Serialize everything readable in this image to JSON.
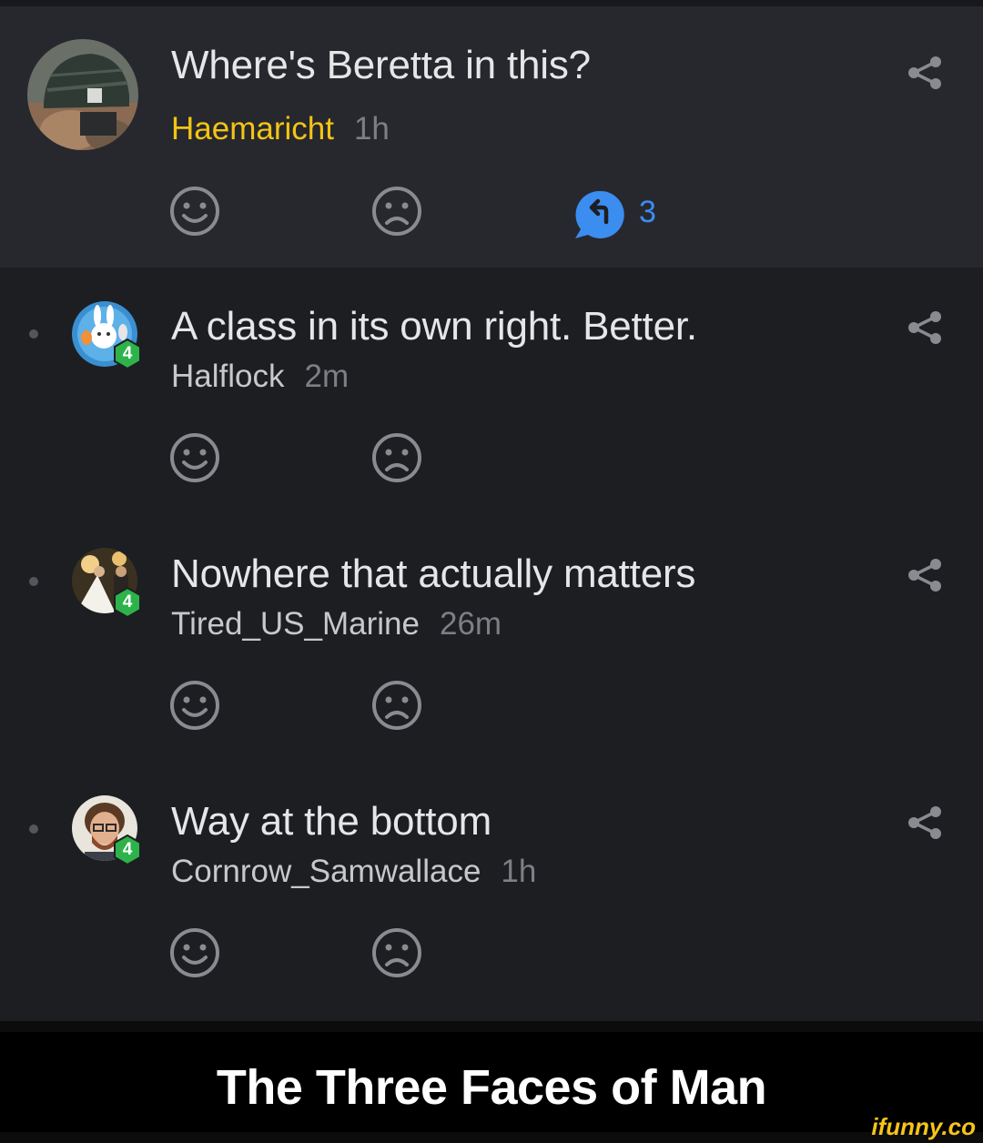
{
  "comments": [
    {
      "text": "Where's Beretta in this?",
      "username": "Haemaricht",
      "time": "1h",
      "is_op": true,
      "replies_count": "3",
      "avatar_icon": "helmet-avatar",
      "badge": ""
    },
    {
      "text": "A class in its own right. Better.",
      "username": "Halflock",
      "time": "2m",
      "avatar_icon": "bunny-avatar",
      "badge": "4"
    },
    {
      "text": "Nowhere that actually matters",
      "username": "Tired_US_Marine",
      "time": "26m",
      "avatar_icon": "wedding-avatar",
      "badge": "4"
    },
    {
      "text": "Way at the bottom",
      "username": "Cornrow_Samwallace",
      "time": "1h",
      "avatar_icon": "bearded-man-avatar",
      "badge": "4"
    }
  ],
  "caption": "The Three Faces of Man",
  "watermark": "ifunny.co",
  "colors": {
    "op_username": "#f3c515",
    "reply_accent": "#3b8df0",
    "badge_green": "#2db34a",
    "background": "#1d1e22",
    "top_comment_bg": "#27282d"
  }
}
